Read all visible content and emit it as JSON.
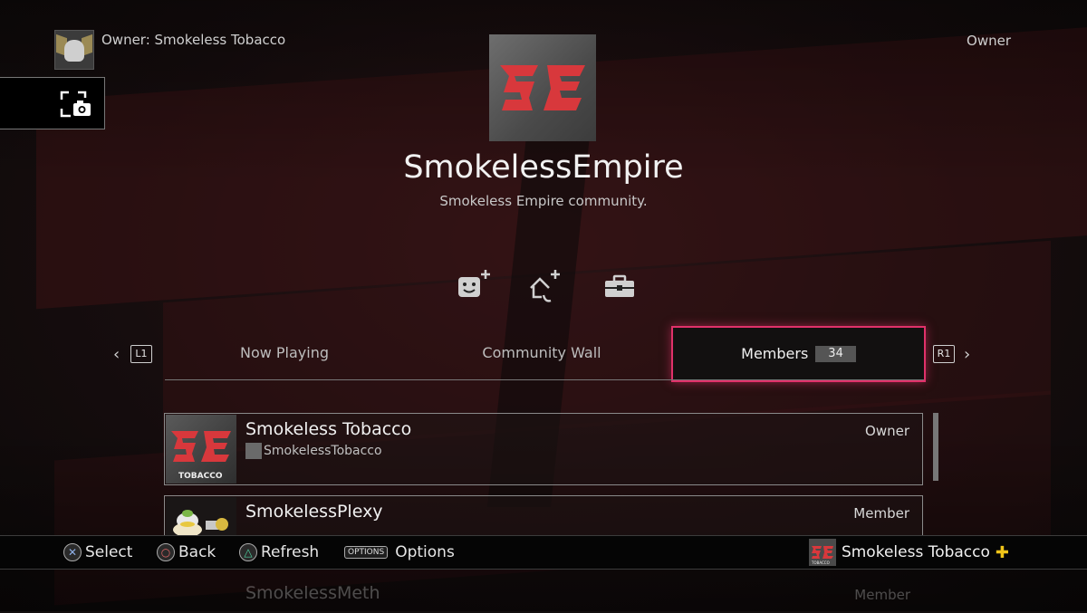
{
  "header": {
    "owner_label": "Owner: Smokeless Tobacco",
    "role": "Owner"
  },
  "community": {
    "name": "SmokelessEmpire",
    "description": "Smokeless Empire community."
  },
  "tabs": {
    "left_key": "L1",
    "right_key": "R1",
    "items": [
      {
        "label": "Now Playing"
      },
      {
        "label": "Community Wall"
      },
      {
        "label": "Members",
        "count": "34"
      }
    ]
  },
  "members": [
    {
      "name": "Smokeless Tobacco",
      "psn_id": "SmokelessTobacco",
      "role": "Owner",
      "thumb_caption": "TOBACCO"
    },
    {
      "name": "SmokelessPlexy",
      "role": "Member"
    },
    {
      "name": "SmokelessMeth",
      "role": "Member"
    }
  ],
  "bottom_bar": {
    "select": "Select",
    "back": "Back",
    "refresh": "Refresh",
    "options_key": "OPTIONS",
    "options": "Options",
    "current_user": "Smokeless Tobacco",
    "user_thumb_caption": "TOBACCO",
    "plus_icon": "playstation-plus-icon"
  },
  "colors": {
    "focus": "#e0316a",
    "logo_red": "#d8383c",
    "plus_yellow": "#f0c419"
  }
}
